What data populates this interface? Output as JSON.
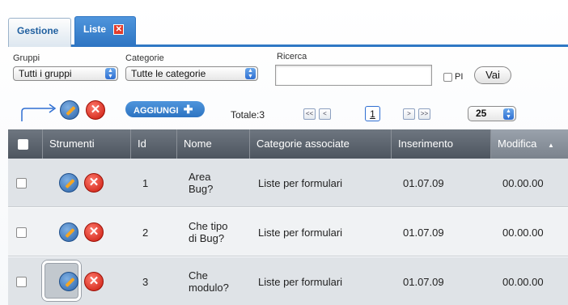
{
  "tabs": [
    {
      "label": "Gestione",
      "active": false
    },
    {
      "label": "Liste",
      "active": true
    }
  ],
  "filters": {
    "gruppi_label": "Gruppi",
    "gruppi_value": "Tutti i gruppi",
    "categorie_label": "Categorie",
    "categorie_value": "Tutte le categorie",
    "ricerca_label": "Ricerca",
    "ricerca_value": "",
    "pi_label": "PI",
    "vai_label": "Vai"
  },
  "toolbar": {
    "add_label": "AGGIUNGI",
    "totale": "Totale:3",
    "first": "<<",
    "prev": "<",
    "page": "1",
    "next": ">",
    "last": ">>",
    "per_page": "25"
  },
  "table": {
    "headers": [
      "Strumenti",
      "Id",
      "Nome",
      "Categorie associate",
      "Inserimento",
      "Modifica"
    ],
    "sort_indicator": "▲",
    "rows": [
      {
        "id": "1",
        "nome_line1": "Area",
        "nome_line2": "Bug?",
        "categorie": "Liste per formulari",
        "inserimento": "01.07.09",
        "modifica": "00.00.00"
      },
      {
        "id": "2",
        "nome_line1": "Che tipo",
        "nome_line2": "di Bug?",
        "categorie": "Liste per formulari",
        "inserimento": "01.07.09",
        "modifica": "00.00.00"
      },
      {
        "id": "3",
        "nome_line1": "Che",
        "nome_line2": "modulo?",
        "categorie": "Liste per formulari",
        "inserimento": "01.07.09",
        "modifica": "00.00.00"
      }
    ]
  },
  "colors": {
    "accent": "#2d74c2",
    "delete": "#c9170a",
    "header_bg": "#4d555f"
  }
}
